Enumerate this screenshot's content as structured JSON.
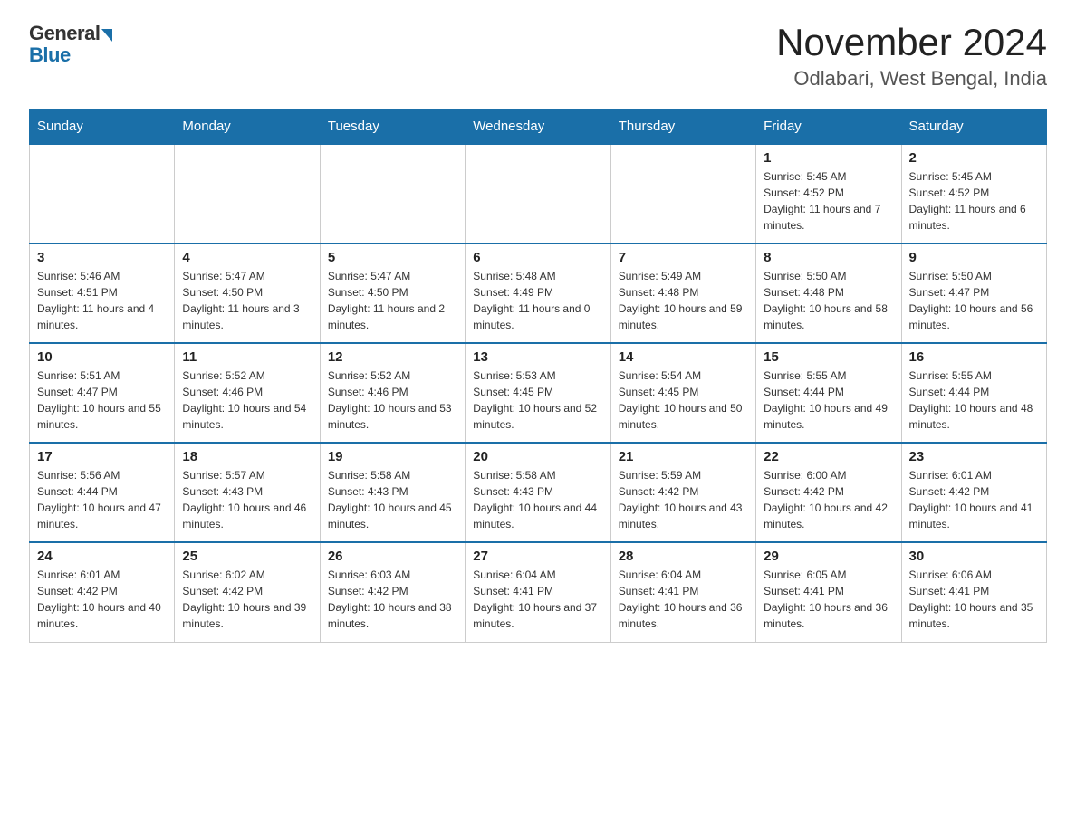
{
  "header": {
    "logo_general": "General",
    "logo_blue": "Blue",
    "month_title": "November 2024",
    "location": "Odlabari, West Bengal, India"
  },
  "days_of_week": [
    "Sunday",
    "Monday",
    "Tuesday",
    "Wednesday",
    "Thursday",
    "Friday",
    "Saturday"
  ],
  "weeks": [
    [
      {
        "day": "",
        "info": ""
      },
      {
        "day": "",
        "info": ""
      },
      {
        "day": "",
        "info": ""
      },
      {
        "day": "",
        "info": ""
      },
      {
        "day": "",
        "info": ""
      },
      {
        "day": "1",
        "info": "Sunrise: 5:45 AM\nSunset: 4:52 PM\nDaylight: 11 hours and 7 minutes."
      },
      {
        "day": "2",
        "info": "Sunrise: 5:45 AM\nSunset: 4:52 PM\nDaylight: 11 hours and 6 minutes."
      }
    ],
    [
      {
        "day": "3",
        "info": "Sunrise: 5:46 AM\nSunset: 4:51 PM\nDaylight: 11 hours and 4 minutes."
      },
      {
        "day": "4",
        "info": "Sunrise: 5:47 AM\nSunset: 4:50 PM\nDaylight: 11 hours and 3 minutes."
      },
      {
        "day": "5",
        "info": "Sunrise: 5:47 AM\nSunset: 4:50 PM\nDaylight: 11 hours and 2 minutes."
      },
      {
        "day": "6",
        "info": "Sunrise: 5:48 AM\nSunset: 4:49 PM\nDaylight: 11 hours and 0 minutes."
      },
      {
        "day": "7",
        "info": "Sunrise: 5:49 AM\nSunset: 4:48 PM\nDaylight: 10 hours and 59 minutes."
      },
      {
        "day": "8",
        "info": "Sunrise: 5:50 AM\nSunset: 4:48 PM\nDaylight: 10 hours and 58 minutes."
      },
      {
        "day": "9",
        "info": "Sunrise: 5:50 AM\nSunset: 4:47 PM\nDaylight: 10 hours and 56 minutes."
      }
    ],
    [
      {
        "day": "10",
        "info": "Sunrise: 5:51 AM\nSunset: 4:47 PM\nDaylight: 10 hours and 55 minutes."
      },
      {
        "day": "11",
        "info": "Sunrise: 5:52 AM\nSunset: 4:46 PM\nDaylight: 10 hours and 54 minutes."
      },
      {
        "day": "12",
        "info": "Sunrise: 5:52 AM\nSunset: 4:46 PM\nDaylight: 10 hours and 53 minutes."
      },
      {
        "day": "13",
        "info": "Sunrise: 5:53 AM\nSunset: 4:45 PM\nDaylight: 10 hours and 52 minutes."
      },
      {
        "day": "14",
        "info": "Sunrise: 5:54 AM\nSunset: 4:45 PM\nDaylight: 10 hours and 50 minutes."
      },
      {
        "day": "15",
        "info": "Sunrise: 5:55 AM\nSunset: 4:44 PM\nDaylight: 10 hours and 49 minutes."
      },
      {
        "day": "16",
        "info": "Sunrise: 5:55 AM\nSunset: 4:44 PM\nDaylight: 10 hours and 48 minutes."
      }
    ],
    [
      {
        "day": "17",
        "info": "Sunrise: 5:56 AM\nSunset: 4:44 PM\nDaylight: 10 hours and 47 minutes."
      },
      {
        "day": "18",
        "info": "Sunrise: 5:57 AM\nSunset: 4:43 PM\nDaylight: 10 hours and 46 minutes."
      },
      {
        "day": "19",
        "info": "Sunrise: 5:58 AM\nSunset: 4:43 PM\nDaylight: 10 hours and 45 minutes."
      },
      {
        "day": "20",
        "info": "Sunrise: 5:58 AM\nSunset: 4:43 PM\nDaylight: 10 hours and 44 minutes."
      },
      {
        "day": "21",
        "info": "Sunrise: 5:59 AM\nSunset: 4:42 PM\nDaylight: 10 hours and 43 minutes."
      },
      {
        "day": "22",
        "info": "Sunrise: 6:00 AM\nSunset: 4:42 PM\nDaylight: 10 hours and 42 minutes."
      },
      {
        "day": "23",
        "info": "Sunrise: 6:01 AM\nSunset: 4:42 PM\nDaylight: 10 hours and 41 minutes."
      }
    ],
    [
      {
        "day": "24",
        "info": "Sunrise: 6:01 AM\nSunset: 4:42 PM\nDaylight: 10 hours and 40 minutes."
      },
      {
        "day": "25",
        "info": "Sunrise: 6:02 AM\nSunset: 4:42 PM\nDaylight: 10 hours and 39 minutes."
      },
      {
        "day": "26",
        "info": "Sunrise: 6:03 AM\nSunset: 4:42 PM\nDaylight: 10 hours and 38 minutes."
      },
      {
        "day": "27",
        "info": "Sunrise: 6:04 AM\nSunset: 4:41 PM\nDaylight: 10 hours and 37 minutes."
      },
      {
        "day": "28",
        "info": "Sunrise: 6:04 AM\nSunset: 4:41 PM\nDaylight: 10 hours and 36 minutes."
      },
      {
        "day": "29",
        "info": "Sunrise: 6:05 AM\nSunset: 4:41 PM\nDaylight: 10 hours and 36 minutes."
      },
      {
        "day": "30",
        "info": "Sunrise: 6:06 AM\nSunset: 4:41 PM\nDaylight: 10 hours and 35 minutes."
      }
    ]
  ]
}
